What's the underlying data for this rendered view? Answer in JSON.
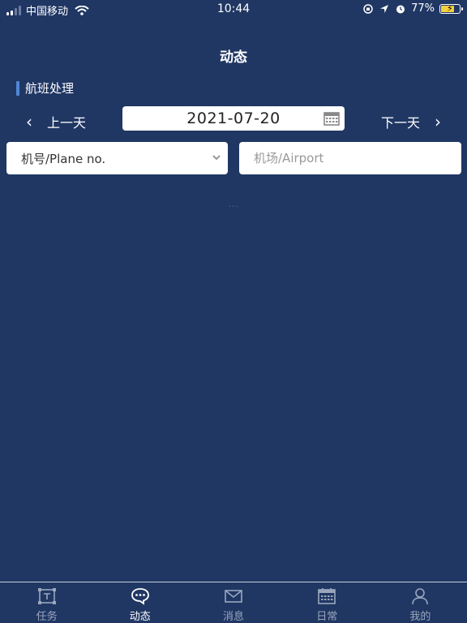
{
  "status_bar": {
    "carrier": "中国移动",
    "time": "10:44",
    "battery": "77%",
    "battery_level": 0.77
  },
  "header": {
    "title": "动态"
  },
  "section": {
    "title": "航班处理"
  },
  "date_nav": {
    "prev_label": "上一天",
    "next_label": "下一天",
    "date": "2021-07-20"
  },
  "filters": {
    "plane_select_value": "机号/Plane no.",
    "airport_placeholder": "机场/Airport"
  },
  "loading": "...",
  "tab_bar": {
    "items": [
      {
        "label": "任务",
        "icon": "task-icon",
        "active": false
      },
      {
        "label": "动态",
        "icon": "chat-bubble-icon",
        "active": true
      },
      {
        "label": "消息",
        "icon": "mail-icon",
        "active": false
      },
      {
        "label": "日常",
        "icon": "calendar-icon",
        "active": false
      },
      {
        "label": "我的",
        "icon": "user-icon",
        "active": false
      }
    ]
  },
  "colors": {
    "background": "#203764",
    "accent": "#4f86d6",
    "tab_inactive": "#9ba6bd",
    "battery_fill": "#f4d03f"
  }
}
